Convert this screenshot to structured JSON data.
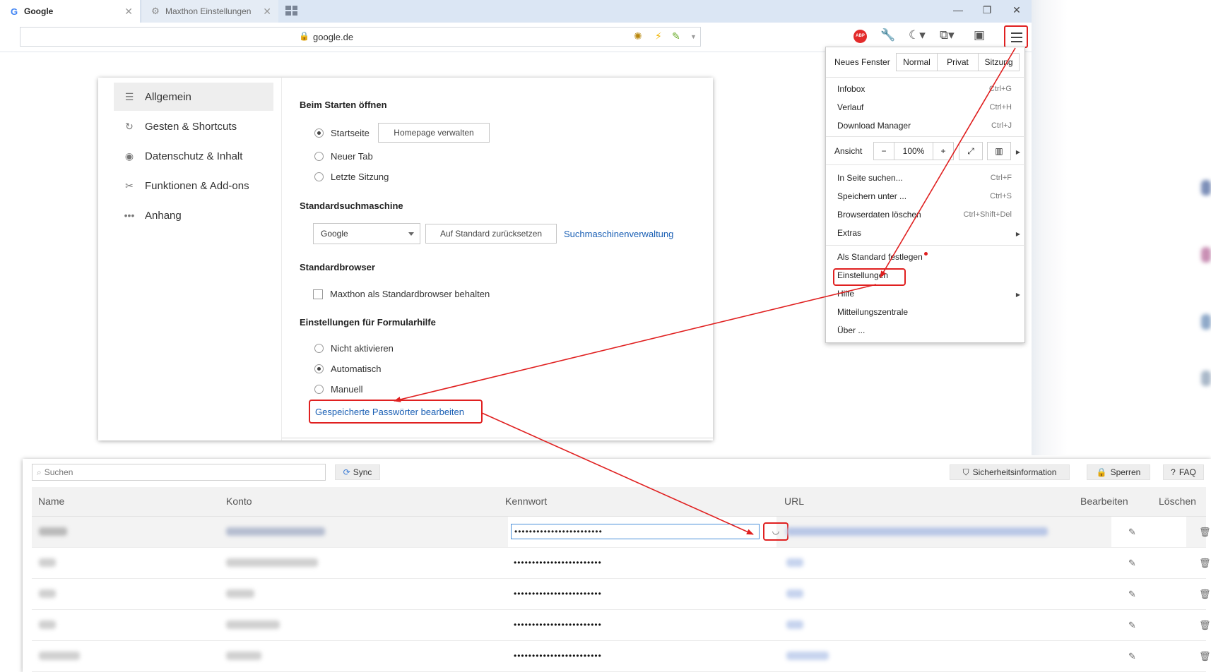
{
  "browser": {
    "tabs": [
      {
        "label": "Google",
        "active": true
      },
      {
        "label": "Maxthon Einstellungen",
        "active": false
      }
    ],
    "url": "google.de"
  },
  "settings": {
    "sidebar": [
      {
        "label": "Allgemein",
        "icon": "sliders-icon",
        "active": true
      },
      {
        "label": "Gesten & Shortcuts",
        "icon": "gesture-icon",
        "active": false
      },
      {
        "label": "Datenschutz & Inhalt",
        "icon": "eye-icon",
        "active": false
      },
      {
        "label": "Funktionen & Add-ons",
        "icon": "tools-icon",
        "active": false
      },
      {
        "label": "Anhang",
        "icon": "more-icon",
        "active": false
      }
    ],
    "startup": {
      "title": "Beim Starten öffnen",
      "options": [
        "Startseite",
        "Neuer Tab",
        "Letzte Sitzung"
      ],
      "selected": "Startseite",
      "homepage_button": "Homepage verwalten"
    },
    "search": {
      "title": "Standardsuchmaschine",
      "engine": "Google",
      "reset_button": "Auf Standard zurücksetzen",
      "manage_link": "Suchmaschinenverwaltung"
    },
    "default_browser": {
      "title": "Standardbrowser",
      "checkbox_label": "Maxthon als Standardbrowser behalten"
    },
    "form_helper": {
      "title": "Einstellungen für Formularhilfe",
      "options": [
        "Nicht aktivieren",
        "Automatisch",
        "Manuell"
      ],
      "selected": "Automatisch",
      "passwords_link": "Gespeicherte Passwörter bearbeiten"
    }
  },
  "menu": {
    "new_window": "Neues Fenster",
    "window_modes": [
      "Normal",
      "Privat",
      "Sitzung"
    ],
    "items_group1": [
      {
        "label": "Infobox",
        "shortcut": "Ctrl+G"
      },
      {
        "label": "Verlauf",
        "shortcut": "Ctrl+H"
      },
      {
        "label": "Download Manager",
        "shortcut": "Ctrl+J"
      }
    ],
    "view_label": "Ansicht",
    "zoom_minus": "−",
    "zoom": "100%",
    "zoom_plus": "+",
    "items_group2": [
      {
        "label": "In Seite suchen...",
        "shortcut": "Ctrl+F"
      },
      {
        "label": "Speichern unter ...",
        "shortcut": "Ctrl+S"
      },
      {
        "label": "Browserdaten löschen",
        "shortcut": "Ctrl+Shift+Del"
      },
      {
        "label": "Extras",
        "shortcut": ""
      }
    ],
    "items_group3": [
      {
        "label": "Als Standard festlegen"
      },
      {
        "label": "Einstellungen"
      },
      {
        "label": "Hilfe"
      },
      {
        "label": "Mitteilungszentrale"
      },
      {
        "label": "Über ..."
      }
    ]
  },
  "password_manager": {
    "search_placeholder": "Suchen",
    "sync_label": "Sync",
    "security_label": "Sicherheitsinformation",
    "lock_label": "Sperren",
    "faq_label": "FAQ",
    "columns": [
      "Name",
      "Konto",
      "Kennwort",
      "URL",
      "Bearbeiten",
      "Löschen"
    ],
    "rows": [
      {
        "password": "••••••••••••••••••••••••"
      },
      {
        "password": "••••••••••••••••••••••••"
      },
      {
        "password": "••••••••••••••••••••••••"
      },
      {
        "password": "••••••••••••••••••••••••"
      },
      {
        "password": "••••••••••••••••••••••••"
      }
    ]
  },
  "colors": {
    "accent": "#1a5fb4",
    "annotation": "#e02020",
    "tab_bar": "#dbe6f4"
  }
}
